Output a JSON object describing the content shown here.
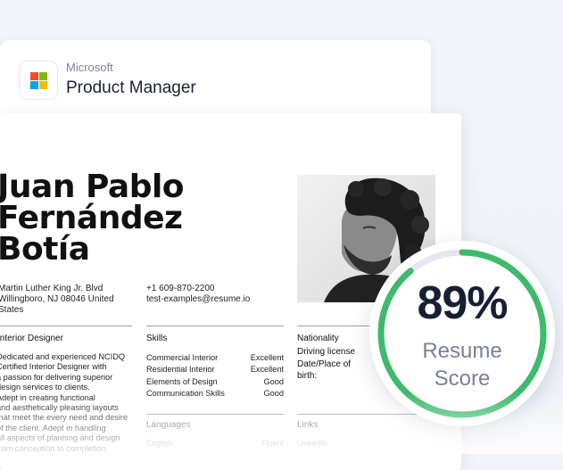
{
  "job": {
    "company": "Microsoft",
    "title": "Product Manager",
    "logo_colors": [
      "#f25022",
      "#7fba00",
      "#00a4ef",
      "#ffb900"
    ]
  },
  "resume": {
    "name_lines": [
      "Juan Pablo",
      "Fernández",
      "Botía"
    ],
    "address_lines": [
      "Martin Luther King Jr. Blvd",
      "Willingboro, NJ 08046 United",
      "States"
    ],
    "phone": "+1 609-870-2200",
    "email": "test-examples@resume.io",
    "profile_title": "Interior Designer",
    "profile_lines": [
      "Dedicated and experienced NCIDQ",
      "Certified Interior Designer with",
      "a passion for delivering superior",
      "design services to clients.",
      "Adept in creating functional",
      "and aesthetically pleasing layouts",
      "that meet the every need and desire",
      "of the client. Adept in handling",
      "all aspects of planning and design",
      "from conception to completion."
    ],
    "skills_title": "Skills",
    "skills": [
      {
        "name": "Commercial Interior",
        "level": "Excellent"
      },
      {
        "name": "Residential Interior",
        "level": "Excellent"
      },
      {
        "name": "Elements of Design",
        "level": "Good"
      },
      {
        "name": "Communication Skills",
        "level": "Good"
      }
    ],
    "personal_labels": [
      "Nationality",
      "Driving license",
      "Date/Place of",
      "birth:"
    ],
    "languages_title": "Languages",
    "languages": [
      {
        "name": "English",
        "level": "Fluent"
      }
    ],
    "links_title": "Links",
    "links": [
      "Linkedin"
    ]
  },
  "score": {
    "value": "89%",
    "label_line1": "Resume",
    "label_line2": "Score",
    "fraction": 0.89,
    "ring_color": "#3dbb6b",
    "track_color": "#e4e7f1"
  }
}
